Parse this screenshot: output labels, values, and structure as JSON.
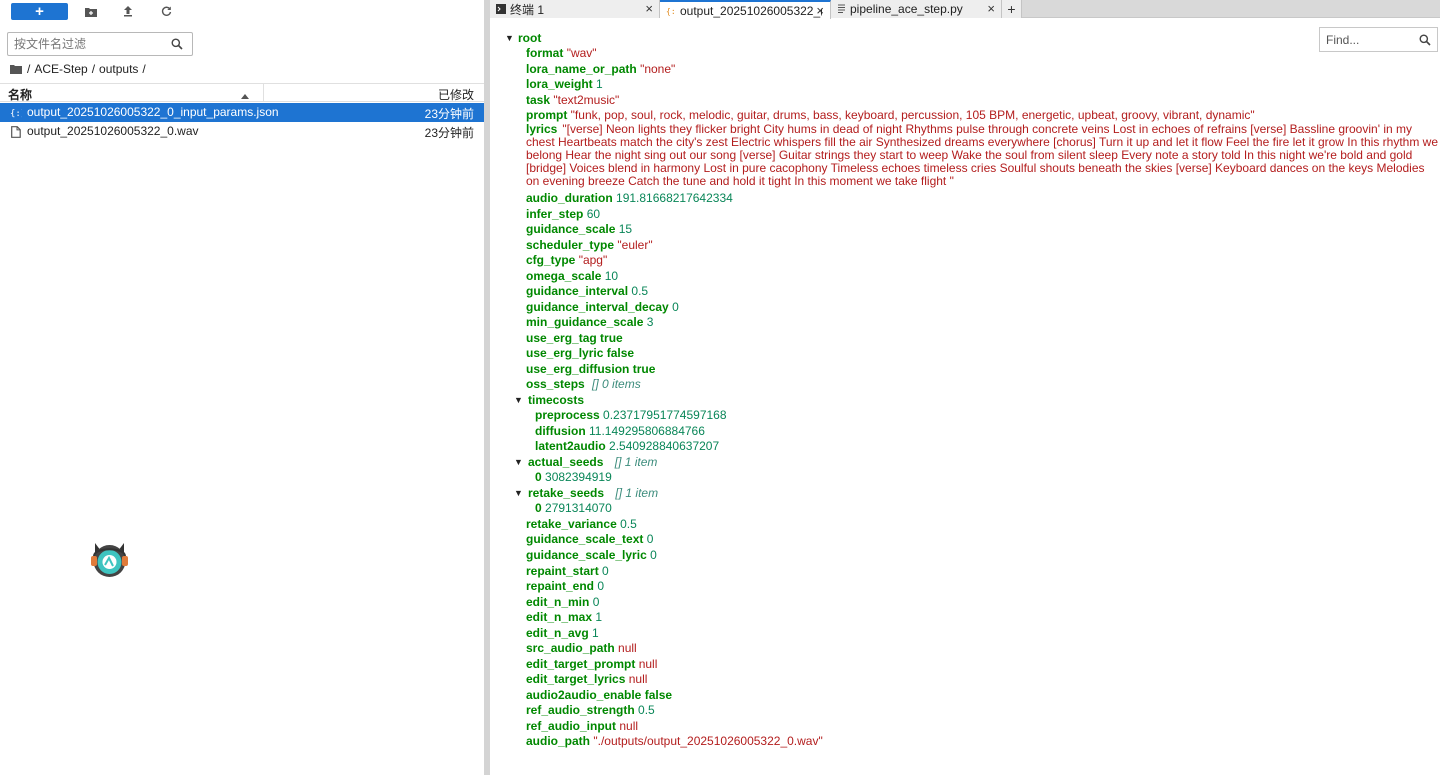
{
  "left": {
    "new_label": "+",
    "filter_placeholder": "按文件名过滤",
    "breadcrumb": [
      "/",
      "ACE-Step",
      "/",
      "outputs",
      "/"
    ],
    "columns": {
      "name": "名称",
      "modified": "已修改"
    },
    "files": [
      {
        "name": "output_20251026005322_0_input_params.json",
        "modified": "23分钟前",
        "icon": "json-icon",
        "selected": true
      },
      {
        "name": "output_20251026005322_0.wav",
        "modified": "23分钟前",
        "icon": "file-icon",
        "selected": false
      }
    ]
  },
  "tabs": [
    {
      "label": "终端 1",
      "icon": "terminal-icon",
      "close": "×"
    },
    {
      "label": "output_20251026005322_(",
      "icon": "json-icon",
      "close": "×"
    },
    {
      "label": "pipeline_ace_step.py",
      "icon": "document-icon",
      "close": "×"
    }
  ],
  "tab_add": "+",
  "find_placeholder": "Find...",
  "tree": {
    "root": "root",
    "format": {
      "k": "format",
      "v": "\"wav\""
    },
    "lora_name": {
      "k": "lora_name_or_path",
      "v": "\"none\""
    },
    "lora_weight": {
      "k": "lora_weight",
      "v": "1"
    },
    "task": {
      "k": "task",
      "v": "\"text2music\""
    },
    "prompt": {
      "k": "prompt",
      "v": "\"funk, pop, soul, rock, melodic, guitar, drums, bass, keyboard, percussion, 105 BPM, energetic, upbeat, groovy, vibrant, dynamic\""
    },
    "lyrics": {
      "k": "lyrics",
      "v": "\"[verse] Neon lights they flicker bright City hums in dead of night Rhythms pulse through concrete veins Lost in echoes of refrains [verse] Bassline groovin' in my chest Heartbeats match the city's zest Electric whispers fill the air Synthesized dreams everywhere [chorus] Turn it up and let it flow Feel the fire let it grow In this rhythm we belong Hear the night sing out our song [verse] Guitar strings they start to weep Wake the soul from silent sleep Every note a story told In this night we're bold and gold [bridge] Voices blend in harmony Lost in pure cacophony Timeless echoes timeless cries Soulful shouts beneath the skies [verse] Keyboard dances on the keys Melodies on evening breeze Catch the tune and hold it tight In this moment we take flight \""
    },
    "audio_duration": {
      "k": "audio_duration",
      "v": "191.81668217642334"
    },
    "infer_step": {
      "k": "infer_step",
      "v": "60"
    },
    "guidance_scale": {
      "k": "guidance_scale",
      "v": "15"
    },
    "scheduler_type": {
      "k": "scheduler_type",
      "v": "\"euler\""
    },
    "cfg_type": {
      "k": "cfg_type",
      "v": "\"apg\""
    },
    "omega_scale": {
      "k": "omega_scale",
      "v": "10"
    },
    "guidance_interval": {
      "k": "guidance_interval",
      "v": "0.5"
    },
    "guidance_interval_decay": {
      "k": "guidance_interval_decay",
      "v": "0"
    },
    "min_guidance_scale": {
      "k": "min_guidance_scale",
      "v": "3"
    },
    "use_erg_tag": {
      "k": "use_erg_tag",
      "v": "true"
    },
    "use_erg_lyric": {
      "k": "use_erg_lyric",
      "v": "false"
    },
    "use_erg_diffusion": {
      "k": "use_erg_diffusion",
      "v": "true"
    },
    "oss_steps": {
      "k": "oss_steps",
      "v": "[]  0 items"
    },
    "timecosts": {
      "k": "timecosts"
    },
    "preprocess": {
      "k": "preprocess",
      "v": "0.23717951774597168"
    },
    "diffusion": {
      "k": "diffusion",
      "v": "11.149295806884766"
    },
    "latent2audio": {
      "k": "latent2audio",
      "v": "2.540928840637207"
    },
    "actual_seeds": {
      "k": "actual_seeds",
      "meta": "[]  1 item"
    },
    "actual_seed_0": {
      "k": "0",
      "v": "3082394919"
    },
    "retake_seeds": {
      "k": "retake_seeds",
      "meta": "[]  1 item"
    },
    "retake_seed_0": {
      "k": "0",
      "v": "2791314070"
    },
    "retake_variance": {
      "k": "retake_variance",
      "v": "0.5"
    },
    "guidance_scale_text": {
      "k": "guidance_scale_text",
      "v": "0"
    },
    "guidance_scale_lyric": {
      "k": "guidance_scale_lyric",
      "v": "0"
    },
    "repaint_start": {
      "k": "repaint_start",
      "v": "0"
    },
    "repaint_end": {
      "k": "repaint_end",
      "v": "0"
    },
    "edit_n_min": {
      "k": "edit_n_min",
      "v": "0"
    },
    "edit_n_max": {
      "k": "edit_n_max",
      "v": "1"
    },
    "edit_n_avg": {
      "k": "edit_n_avg",
      "v": "1"
    },
    "src_audio_path": {
      "k": "src_audio_path",
      "v": "null"
    },
    "edit_target_prompt": {
      "k": "edit_target_prompt",
      "v": "null"
    },
    "edit_target_lyrics": {
      "k": "edit_target_lyrics",
      "v": "null"
    },
    "audio2audio_enable": {
      "k": "audio2audio_enable",
      "v": "false"
    },
    "ref_audio_strength": {
      "k": "ref_audio_strength",
      "v": "0.5"
    },
    "ref_audio_input": {
      "k": "ref_audio_input",
      "v": "null"
    },
    "audio_path": {
      "k": "audio_path",
      "v": "\"./outputs/output_20251026005322_0.wav\""
    }
  },
  "colors": {
    "accent": "#1e74d2",
    "key": "#008800",
    "string": "#b31d1d",
    "number": "#098658"
  }
}
